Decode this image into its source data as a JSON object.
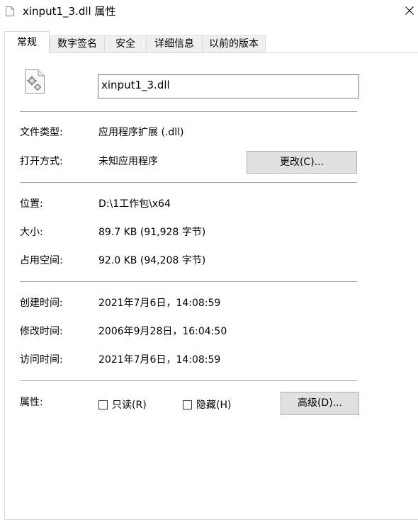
{
  "window": {
    "title": "xinput1_3.dll 属性",
    "close_icon": "close-icon"
  },
  "tabs": [
    {
      "label": "常规",
      "active": true
    },
    {
      "label": "数字签名",
      "active": false
    },
    {
      "label": "安全",
      "active": false
    },
    {
      "label": "详细信息",
      "active": false
    },
    {
      "label": "以前的版本",
      "active": false
    }
  ],
  "general": {
    "file_icon": "dll-gear-file-icon",
    "file_name": "xinput1_3.dll",
    "type_label": "文件类型:",
    "type_value": "应用程序扩展 (.dll)",
    "opens_with_label": "打开方式:",
    "opens_with_value": "未知应用程序",
    "change_button": "更改(C)...",
    "location_label": "位置:",
    "location_value": "D:\\1工作包\\x64",
    "size_label": "大小:",
    "size_value": "89.7 KB (91,928 字节)",
    "size_on_disk_label": "占用空间:",
    "size_on_disk_value": "92.0 KB (94,208 字节)",
    "created_label": "创建时间:",
    "created_value": "2021年7月6日，14:08:59",
    "modified_label": "修改时间:",
    "modified_value": "2006年9月28日，16:04:50",
    "accessed_label": "访问时间:",
    "accessed_value": "2021年7月6日，14:08:59",
    "attributes_label": "属性:",
    "readonly_label": "只读(R)",
    "readonly_checked": false,
    "hidden_label": "隐藏(H)",
    "hidden_checked": false,
    "advanced_button": "高级(D)..."
  },
  "colors": {
    "background": "#ffffff",
    "tab_inactive": "#f0f0f0",
    "border": "#d9d9d9",
    "divider": "#a0a0a0",
    "button_face": "#e1e1e1",
    "button_border": "#adadad"
  }
}
